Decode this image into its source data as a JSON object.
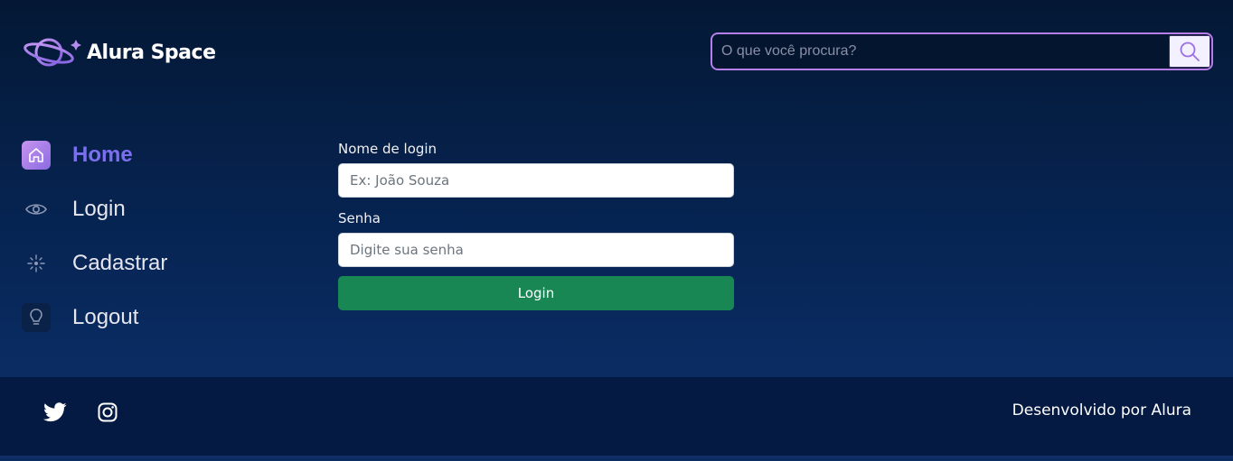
{
  "header": {
    "logo_text": "Alura Space",
    "search": {
      "placeholder": "O que você procura?",
      "value": ""
    },
    "search_icon": "search-icon"
  },
  "sidebar": {
    "items": [
      {
        "label": "Home",
        "icon": "home-icon",
        "active": true
      },
      {
        "label": "Login",
        "icon": "eye-icon",
        "active": false
      },
      {
        "label": "Cadastrar",
        "icon": "sparkle-icon",
        "active": false
      },
      {
        "label": "Logout",
        "icon": "lightbulb-icon",
        "active": false
      }
    ]
  },
  "form": {
    "username_label": "Nome de login",
    "username_placeholder": "Ex: João Souza",
    "password_label": "Senha",
    "password_placeholder": "Digite sua senha",
    "submit_label": "Login"
  },
  "footer": {
    "social": [
      "twitter-icon",
      "instagram-icon"
    ],
    "credit": "Desenvolvido por Alura"
  },
  "colors": {
    "accent": "#7b6ff0",
    "search_border": "#b57ee8",
    "button_green": "#198754",
    "footer_bg": "#041a42"
  }
}
